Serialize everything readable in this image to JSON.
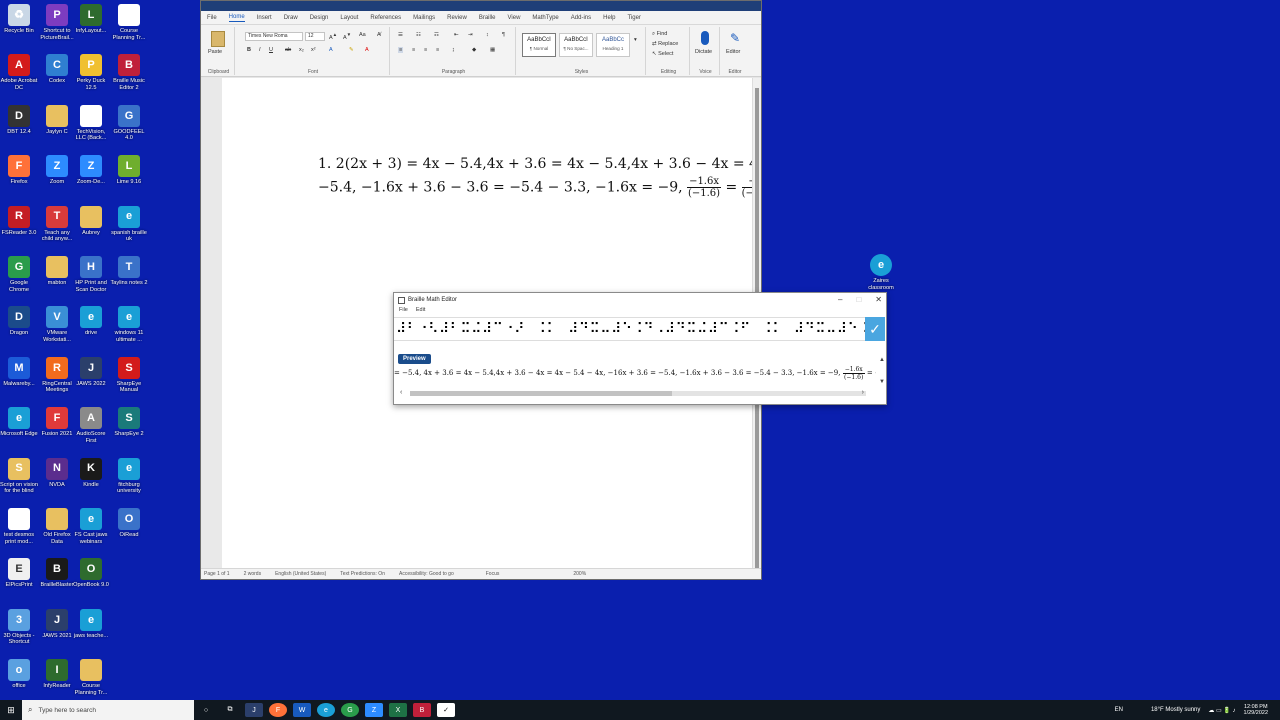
{
  "desktop": {
    "col1": [
      {
        "name": "recycle-bin",
        "label": "Recycle Bin",
        "color": "#c9d7e6",
        "glyph": "♻"
      },
      {
        "name": "adobe-acrobat",
        "label": "Adobe Acrobat DC",
        "color": "#d31b1b",
        "glyph": "A"
      },
      {
        "name": "dbt",
        "label": "DBT 12.4",
        "color": "#333333",
        "glyph": "D"
      },
      {
        "name": "firefox",
        "label": "Firefox",
        "color": "#ff7139",
        "glyph": "F"
      },
      {
        "name": "fsreader",
        "label": "FSReader 3.0",
        "color": "#c41d24",
        "glyph": "R"
      },
      {
        "name": "chrome",
        "label": "Google Chrome",
        "color": "#2a9c4b",
        "glyph": "G"
      },
      {
        "name": "dragon",
        "label": "Dragon",
        "color": "#1b4b8a",
        "glyph": "D"
      },
      {
        "name": "malwarebytes",
        "label": "Malwareby...",
        "color": "#1c5bd8",
        "glyph": "M"
      },
      {
        "name": "edge-1",
        "label": "Microsoft Edge",
        "color": "#1a9fd6",
        "glyph": "e"
      },
      {
        "name": "script-vision",
        "label": "Script on vision for the blind",
        "color": "#e8c060",
        "glyph": "S"
      },
      {
        "name": "desmos",
        "label": "test desmos print mod...",
        "color": "#ffffff",
        "glyph": ""
      },
      {
        "name": "elpicsprint",
        "label": "ElPicsPrint",
        "color": "#f0f0f0",
        "glyph": "E"
      },
      {
        "name": "3d-objects",
        "label": "3D Objects - Shortcut",
        "color": "#5aa0e0",
        "glyph": "3"
      },
      {
        "name": "office",
        "label": "office",
        "color": "#5aa0e0",
        "glyph": "o"
      }
    ],
    "col2": [
      {
        "name": "picturebraille",
        "label": "Shortcut to PictureBrail...",
        "color": "#7d3cc0",
        "glyph": "P"
      },
      {
        "name": "codex",
        "label": "Codex",
        "color": "#2f7fd1",
        "glyph": "C"
      },
      {
        "name": "jaylyn",
        "label": "Jaylyn C",
        "color": "#e8c060",
        "glyph": ""
      },
      {
        "name": "zoom",
        "label": "Zoom",
        "color": "#2d8cff",
        "glyph": "Z"
      },
      {
        "name": "teach-child",
        "label": "Teach any child anyw...",
        "color": "#d83b3b",
        "glyph": "T"
      },
      {
        "name": "mabton",
        "label": "mabton",
        "color": "#e8c060",
        "glyph": ""
      },
      {
        "name": "vmware",
        "label": "VMware Workstati...",
        "color": "#3a8fd6",
        "glyph": "V"
      },
      {
        "name": "ringcentral",
        "label": "RingCentral Meetings",
        "color": "#f26b1d",
        "glyph": "R"
      },
      {
        "name": "fusion",
        "label": "Fusion 2021",
        "color": "#e03a3a",
        "glyph": "F"
      },
      {
        "name": "nvda",
        "label": "NVDA",
        "color": "#5b2d8e",
        "glyph": "N"
      },
      {
        "name": "old-firefox",
        "label": "Old Firefox Data",
        "color": "#e8c060",
        "glyph": ""
      },
      {
        "name": "brailleblaster",
        "label": "BrailleBlaster",
        "color": "#1a1a1a",
        "glyph": "B"
      },
      {
        "name": "jaws-2021",
        "label": "JAWS 2021",
        "color": "#2b3f6b",
        "glyph": "J"
      },
      {
        "name": "intyreader",
        "label": "InfyReader",
        "color": "#2e6b2e",
        "glyph": "I"
      }
    ],
    "col3": [
      {
        "name": "infylayout",
        "label": "InfyLayout...",
        "color": "#2e6b2e",
        "glyph": "L"
      },
      {
        "name": "perky-duck",
        "label": "Perky Duck 12.5",
        "color": "#f0c030",
        "glyph": "P"
      },
      {
        "name": "techvision",
        "label": "TechVision, LLC (Back...",
        "color": "#ffffff",
        "glyph": ""
      },
      {
        "name": "zoom-de",
        "label": "Zoom-De...",
        "color": "#2d8cff",
        "glyph": "Z"
      },
      {
        "name": "aubrey",
        "label": "Aubrey",
        "color": "#e8c060",
        "glyph": ""
      },
      {
        "name": "hp-print",
        "label": "HP Print and Scan Doctor",
        "color": "#3a72c9",
        "glyph": "H"
      },
      {
        "name": "drive",
        "label": "drive",
        "color": "#1a9fd6",
        "glyph": "e"
      },
      {
        "name": "jaws-2022",
        "label": "JAWS 2022",
        "color": "#2b3f6b",
        "glyph": "J"
      },
      {
        "name": "audioscore",
        "label": "AudioScore First",
        "color": "#8a8a8a",
        "glyph": "A"
      },
      {
        "name": "kindle",
        "label": "Kindle",
        "color": "#1a1a1a",
        "glyph": "K"
      },
      {
        "name": "fs-cast",
        "label": "FS Cast jaws webinars",
        "color": "#1a9fd6",
        "glyph": "e"
      },
      {
        "name": "openbook",
        "label": "OpenBook 9.0",
        "color": "#2e6b2e",
        "glyph": "O"
      },
      {
        "name": "jaws-teacher",
        "label": "jaws teache...",
        "color": "#1a9fd6",
        "glyph": "e"
      },
      {
        "name": "course-planning-2",
        "label": "Course Planning Tr...",
        "color": "#e8c060",
        "glyph": ""
      }
    ],
    "col4": [
      {
        "name": "course-planning",
        "label": "Course Planning Tr...",
        "color": "#ffffff",
        "glyph": ""
      },
      {
        "name": "braille-music",
        "label": "Braille Music Editor 2",
        "color": "#c0203a",
        "glyph": "B"
      },
      {
        "name": "goodfeel",
        "label": "GOODFEEL 4.0",
        "color": "#3a72c9",
        "glyph": "G"
      },
      {
        "name": "lime",
        "label": "Lime 9.16",
        "color": "#6fae2e",
        "glyph": "L"
      },
      {
        "name": "spanish-braille",
        "label": "spanish braille uk",
        "color": "#1a9fd6",
        "glyph": "e"
      },
      {
        "name": "taylins-notes",
        "label": "Taylins notes 2",
        "color": "#3a72c9",
        "glyph": "T"
      },
      {
        "name": "windows11",
        "label": "windows 11 ultimate ...",
        "color": "#1a9fd6",
        "glyph": "e"
      },
      {
        "name": "sharpeye-manual",
        "label": "SharpEye Manual",
        "color": "#d31b1b",
        "glyph": "S"
      },
      {
        "name": "sharpeye2",
        "label": "SharpEye 2",
        "color": "#1a7a7a",
        "glyph": "S"
      },
      {
        "name": "fitchburg",
        "label": "fitchburg university",
        "color": "#1a9fd6",
        "glyph": "e"
      },
      {
        "name": "oread",
        "label": "OiRead",
        "color": "#3a72c9",
        "glyph": "O"
      }
    ],
    "right_icon": {
      "label": "Zaires classroom",
      "color": "#1a9fd6",
      "glyph": "e"
    }
  },
  "word": {
    "tabs": [
      "File",
      "Home",
      "Insert",
      "Draw",
      "Design",
      "Layout",
      "References",
      "Mailings",
      "Review",
      "Braille",
      "View",
      "MathType",
      "Add-ins",
      "Help",
      "Tiger"
    ],
    "active_tab": "Home",
    "font_name": "Times New Roma",
    "font_size": "12",
    "groups": {
      "clipboard": "Clipboard",
      "font": "Font",
      "paragraph": "Paragraph",
      "styles": "Styles",
      "editing": "Editing",
      "voice": "Voice",
      "editor": "Editor"
    },
    "paste_label": "Paste",
    "styles": [
      {
        "sample": "AaBbCcI",
        "name": "¶ Normal"
      },
      {
        "sample": "AaBbCcI",
        "name": "¶ No Spac..."
      },
      {
        "sample": "AaBbCc",
        "name": "Heading 1"
      }
    ],
    "editing": {
      "find": "Find",
      "replace": "Replace",
      "select": "Select"
    },
    "dictate": "Dictate",
    "editor_btn": "Editor",
    "math_line1": "1. 2(2x + 3) = 4x − 5.4,4x + 3.6 = 4x − 5.4,4x + 3.6 − 4x = 4",
    "math_line2": "−5.4, −1.6x + 3.6 − 3.6 = −5.4 − 3.3, −1.6x = −9,",
    "frac1_num": "−1.6x",
    "frac1_den": "(−1.6)",
    "math_eq": "=",
    "frac2_num": "−9",
    "frac2_den": "(−1.6",
    "status": {
      "page": "Page 1 of 1",
      "words": "2 words",
      "lang": "English (United States)",
      "predictions": "Text Predictions: On",
      "accessibility": "Accessibility: Good to go",
      "focus": "Focus",
      "zoom": "200%"
    }
  },
  "braille_editor": {
    "title": "Braille Math Editor",
    "menu": [
      "File",
      "Edit"
    ],
    "braille_text": "⠼⠃⠐⠣⠼⠃⠭⠬⠼⠉⠐⠜⠀⠨⠅⠀⠼⠙⠭⠤⠼⠑⠨⠙⠠⠼⠙⠭⠬⠼⠉⠨⠋⠀⠨⠅⠀⠼⠙⠭⠤⠼⠑⠨⠙⠠⠼⠙⠭⠬⠼⠉⠨⠋⠤⠼⠙⠭",
    "preview_label": "Preview",
    "preview_text": "= −5.4, 4x + 3.6 = 4x − 5.4,4x + 3.6 − 4x = 4x − 5.4 − 4x, −16x + 3.6 = −5.4, −1.6x + 3.6 − 3.6 = −5.4 − 3.3, −1.6x = −9,",
    "preview_frac_num": "−1.6x",
    "preview_frac_den": "(−1.6)",
    "preview_tail": "= −9/(−1."
  },
  "taskbar": {
    "search_placeholder": "Type here to search",
    "lang": "EN",
    "weather": "18°F  Mostly sunny",
    "time": "12:08 PM",
    "date": "1/29/2022"
  }
}
